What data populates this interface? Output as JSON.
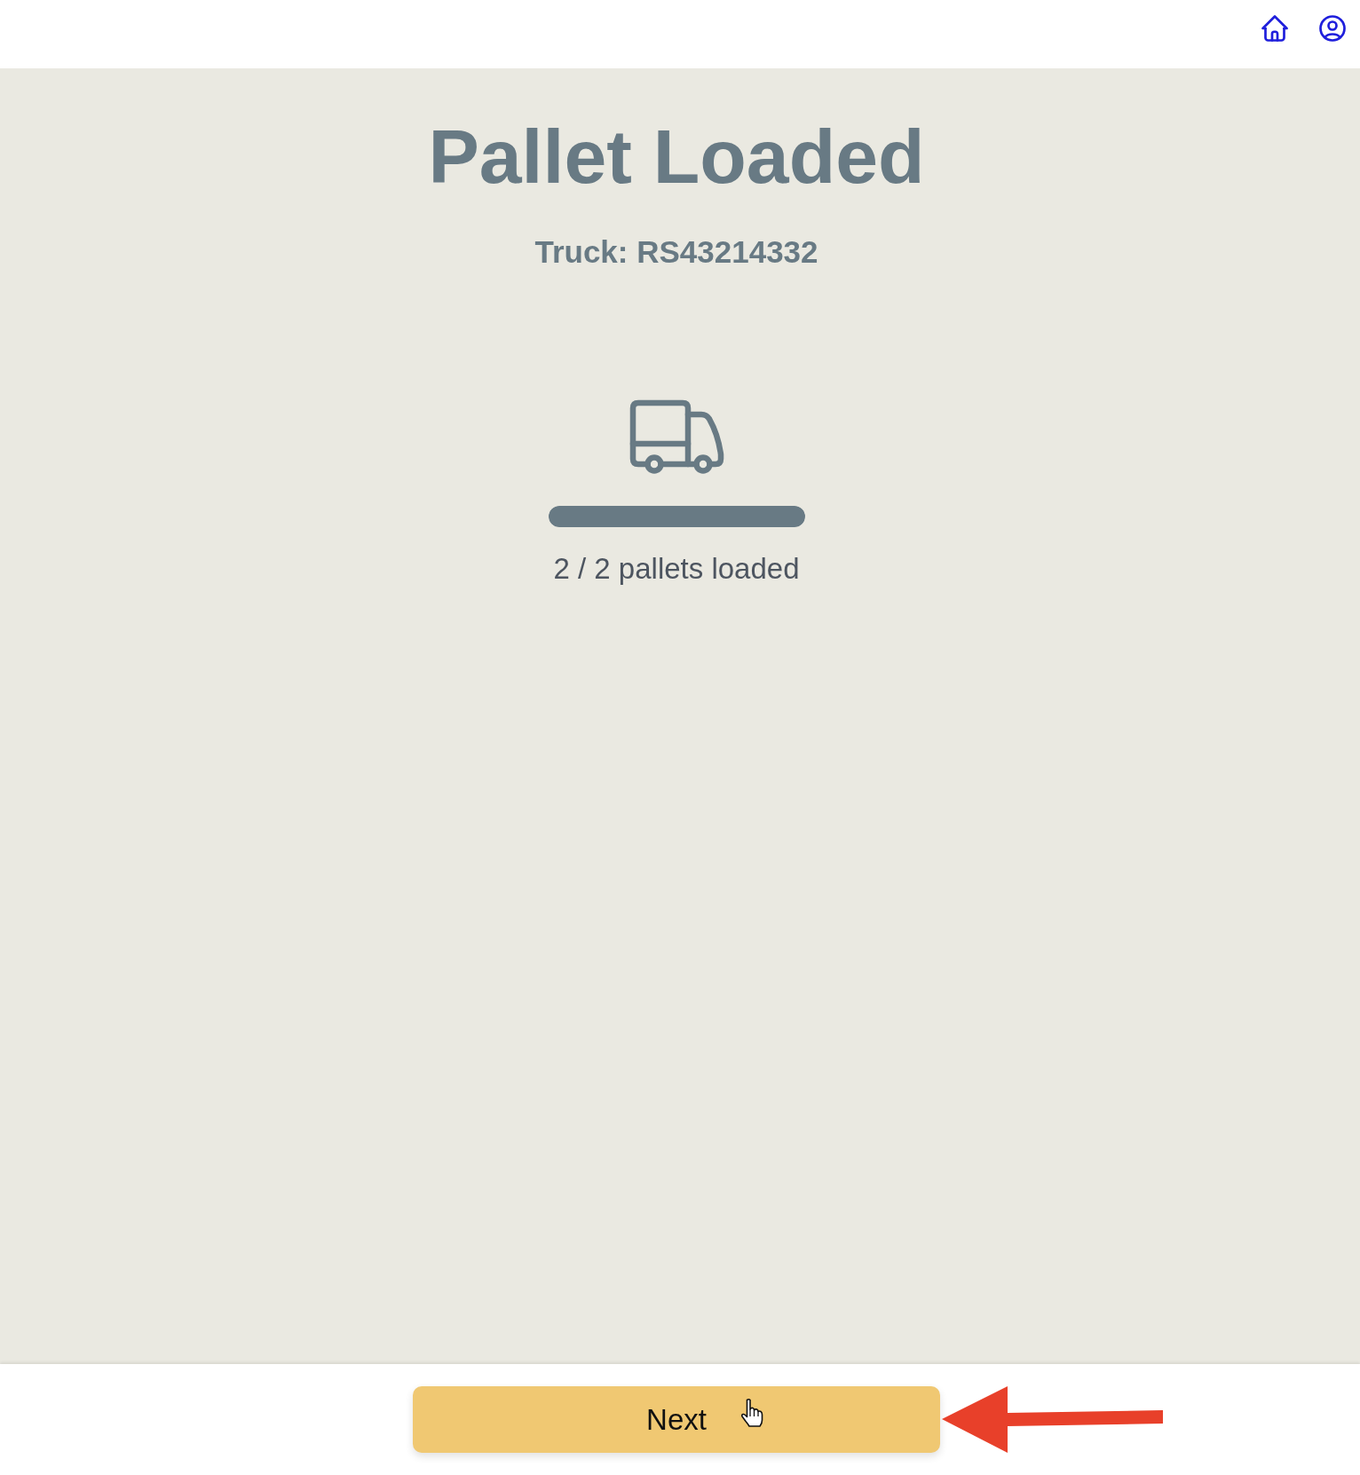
{
  "title": "Pallet Loaded",
  "subtitle": "Truck: RS43214332",
  "progress": {
    "level": 1,
    "reading": "2 / 2 pallets loaded"
  },
  "buttons": [
    {
      "label": "Next",
      "kind": "primary"
    }
  ]
}
